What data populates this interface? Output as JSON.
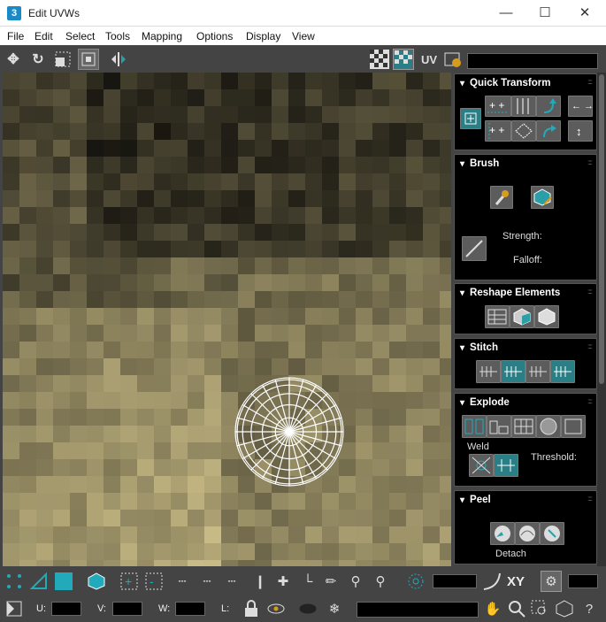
{
  "window": {
    "title": "Edit UVWs",
    "app_icon": "3",
    "minimize": "—",
    "maximize": "☐",
    "close": "✕"
  },
  "menu": [
    "File",
    "Edit",
    "Select",
    "Tools",
    "Mapping",
    "Options",
    "Display",
    "View"
  ],
  "toolbar": {
    "uv_label": "UV"
  },
  "panels": {
    "quick_transform": {
      "title": "Quick Transform"
    },
    "brush": {
      "title": "Brush",
      "strength_label": "Strength:",
      "falloff_label": "Falloff:"
    },
    "reshape": {
      "title": "Reshape Elements"
    },
    "stitch": {
      "title": "Stitch"
    },
    "explode": {
      "title": "Explode",
      "weld_label": "Weld",
      "threshold_label": "Threshold:"
    },
    "peel": {
      "title": "Peel",
      "detach_label": "Detach"
    }
  },
  "bottom": {
    "xy_label": "XY",
    "u_label": "U:",
    "v_label": "V:",
    "w_label": "W:",
    "l_label": "L:"
  },
  "colors": {
    "accent_teal": "#2a7f86",
    "panel_bg": "#000000",
    "chrome": "#444444"
  },
  "icons": [
    "move-icon",
    "rotate-icon",
    "scale-icon",
    "freeform-icon",
    "mirror-icon",
    "checker-icon",
    "texture-icon",
    "settings-icon",
    "brush-icon",
    "relax-icon",
    "stitch-icon",
    "weld-icon",
    "peel-icon",
    "lock-icon",
    "eye-icon",
    "snowflake-icon",
    "hand-icon",
    "zoom-icon"
  ]
}
